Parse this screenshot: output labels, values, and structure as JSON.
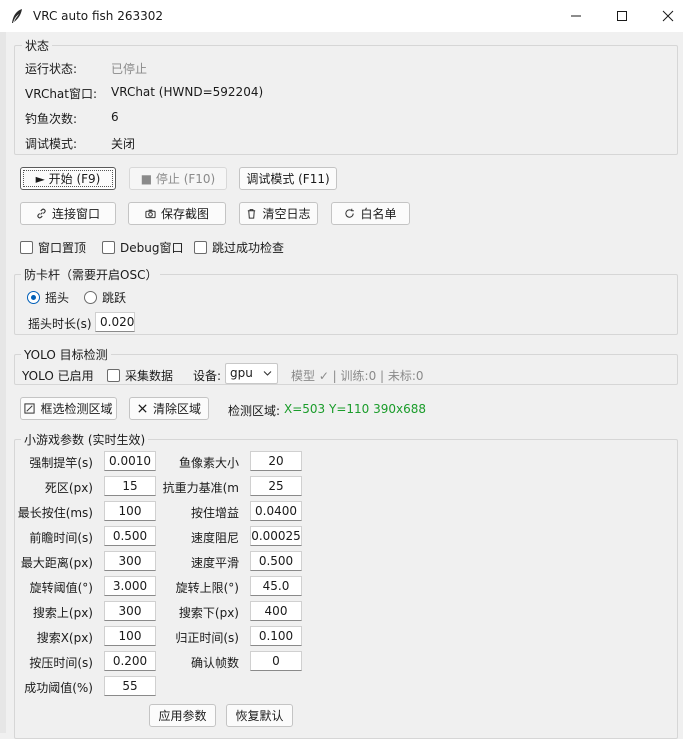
{
  "window": {
    "title": "VRC auto fish 263302"
  },
  "status": {
    "group_label": "状态",
    "rows": [
      {
        "label": "运行状态:",
        "value": "已停止"
      },
      {
        "label": "VRChat窗口:",
        "value": "VRChat (HWND=592204)"
      },
      {
        "label": "钓鱼次数:",
        "value": "6"
      },
      {
        "label": "调试模式:",
        "value": "关闭"
      }
    ]
  },
  "controls": {
    "start": "► 开始 (F9)",
    "stop": "■ 停止 (F10)",
    "debug": "调试模式 (F11)",
    "connect": "连接窗口",
    "screenshot": "保存截图",
    "clear_log": "清空日志",
    "whitelist": "白名单"
  },
  "options": {
    "topmost": "窗口置顶",
    "debug_window": "Debug窗口",
    "skip_check": "跳过成功检查"
  },
  "anti_stuck": {
    "group_label": "防卡杆（需要开启OSC）",
    "radio_shake": "摇头",
    "radio_jump": "跳跃",
    "selected": "摇头",
    "shake_duration_label": "摇头时长(s)",
    "shake_duration_value": "0.020"
  },
  "yolo": {
    "group_label": "YOLO 目标检测",
    "enabled_text": "YOLO 已启用",
    "collect_label": "采集数据",
    "device_label": "设备:",
    "device_value": "gpu",
    "model_status": "模型 ✓ | 训练:0 | 未标:0",
    "select_region": "框选检测区域",
    "clear_region": "清除区域",
    "region_label": "检测区域:",
    "region_value": "X=503 Y=110 390x688"
  },
  "params": {
    "group_label": "小游戏参数 (实时生效)",
    "left": [
      {
        "label": "强制提竿(s)",
        "value": "0.0010"
      },
      {
        "label": "死区(px)",
        "value": "15"
      },
      {
        "label": "最长按住(ms)",
        "value": "100"
      },
      {
        "label": "前瞻时间(s)",
        "value": "0.500"
      },
      {
        "label": "最大距离(px)",
        "value": "300"
      },
      {
        "label": "旋转阈值(°)",
        "value": "3.000"
      },
      {
        "label": "搜索上(px)",
        "value": "300"
      },
      {
        "label": "搜索X(px)",
        "value": "100"
      },
      {
        "label": "按压时间(s)",
        "value": "0.200"
      },
      {
        "label": "成功阈值(%)",
        "value": "55"
      }
    ],
    "right": [
      {
        "label": "鱼像素大小",
        "value": "20"
      },
      {
        "label": "抗重力基准(m",
        "value": "25"
      },
      {
        "label": "按住增益",
        "value": "0.0400"
      },
      {
        "label": "速度阻尼",
        "value": "0.00025"
      },
      {
        "label": "速度平滑",
        "value": "0.500"
      },
      {
        "label": "旋转上限(°)",
        "value": "45.0"
      },
      {
        "label": "搜索下(px)",
        "value": "400"
      },
      {
        "label": "归正时间(s)",
        "value": "0.100"
      },
      {
        "label": "确认帧数",
        "value": "0"
      }
    ],
    "apply": "应用参数",
    "reset": "恢复默认"
  }
}
